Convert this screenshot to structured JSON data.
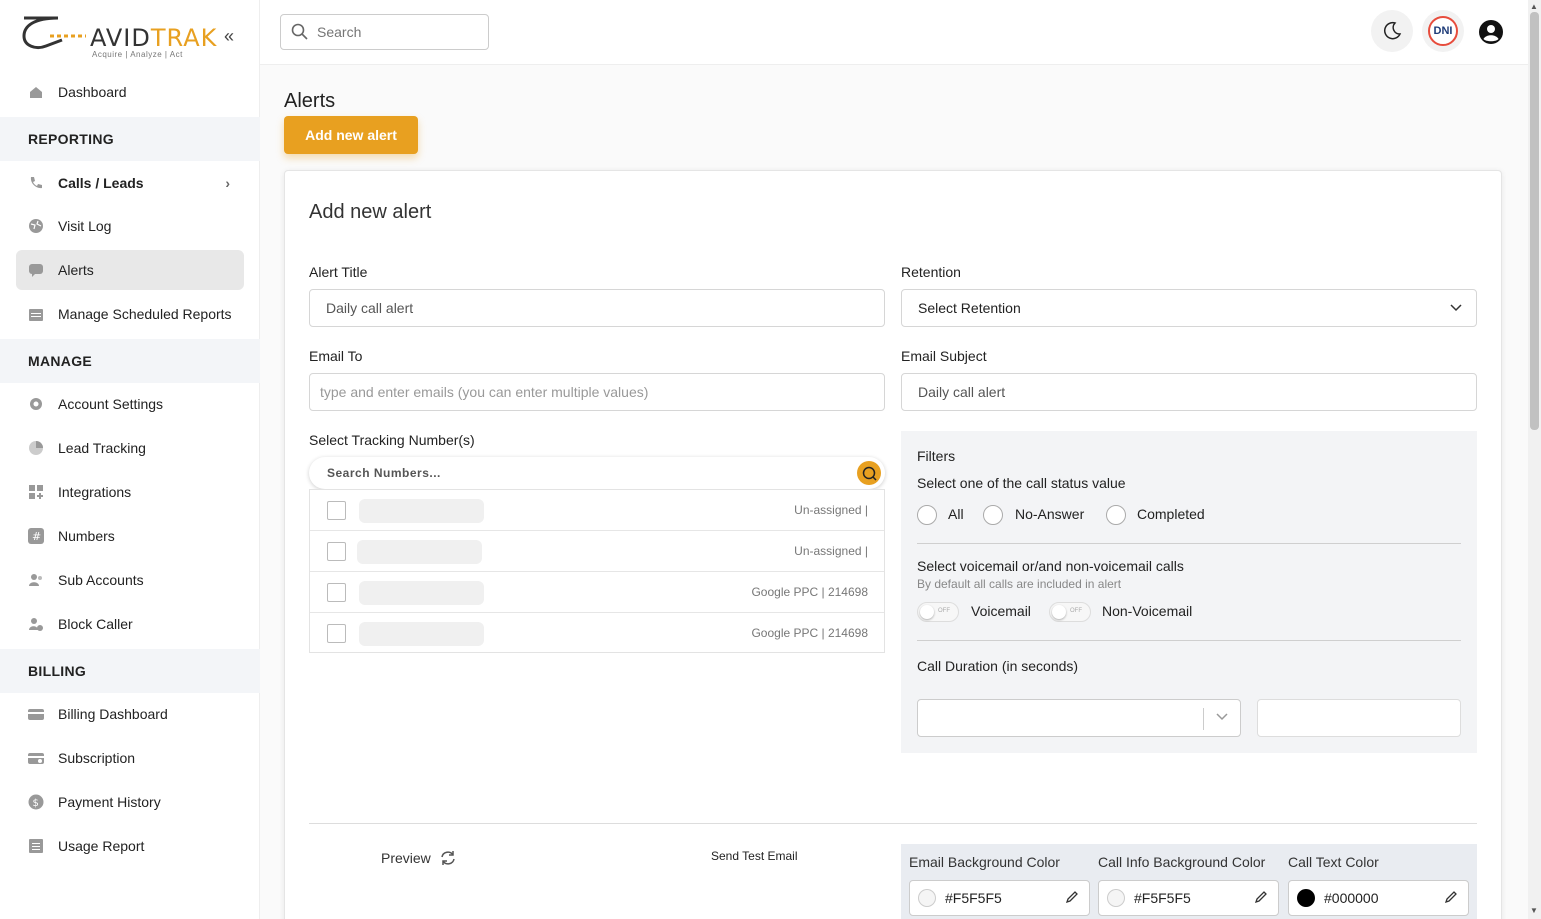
{
  "brand": {
    "name_a": "AVID",
    "name_b": "TRAK",
    "tagline": "Acquire  |  Analyze  |  Act"
  },
  "sidebar": {
    "dashboard": "Dashboard",
    "sections": {
      "reporting": "REPORTING",
      "manage": "MANAGE",
      "billing": "BILLING"
    },
    "reporting_items": [
      "Calls / Leads",
      "Visit Log",
      "Alerts",
      "Manage Scheduled Reports"
    ],
    "manage_items": [
      "Account Settings",
      "Lead Tracking",
      "Integrations",
      "Numbers",
      "Sub Accounts",
      "Block Caller"
    ],
    "billing_items": [
      "Billing Dashboard",
      "Subscription",
      "Payment History",
      "Usage Report"
    ]
  },
  "topbar": {
    "search_placeholder": "Search",
    "dni_label": "DNI"
  },
  "page": {
    "title": "Alerts",
    "add_button": "Add new alert"
  },
  "form": {
    "title": "Add new alert",
    "alert_title_label": "Alert Title",
    "alert_title_value": "Daily call alert",
    "retention_label": "Retention",
    "retention_value": "Select Retention",
    "email_to_label": "Email To",
    "email_to_placeholder": "type and enter emails (you can enter multiple values)",
    "email_subject_label": "Email Subject",
    "email_subject_value": "Daily call alert",
    "tracking_label": "Select Tracking Number(s)",
    "number_search_placeholder": "Search Numbers...",
    "numbers": [
      {
        "source": "Un-assigned |"
      },
      {
        "source": "Un-assigned |"
      },
      {
        "source": "Google PPC | 214698"
      },
      {
        "source": "Google PPC | 214698"
      }
    ]
  },
  "filters": {
    "title": "Filters",
    "status_prompt": "Select one of the call status value",
    "status_options": [
      "All",
      "No-Answer",
      "Completed"
    ],
    "voicemail_prompt": "Select voicemail or/and non-voicemail calls",
    "voicemail_hint": "By default all calls are included in alert",
    "toggle_off": "OFF",
    "voicemail_label": "Voicemail",
    "non_voicemail_label": "Non-Voicemail",
    "duration_label": "Call Duration (in seconds)"
  },
  "footer": {
    "preview_label": "Preview",
    "send_test_label": "Send Test Email",
    "colors": [
      {
        "label": "Email Background Color",
        "value": "#F5F5F5",
        "swatch": "#F5F5F5"
      },
      {
        "label": "Call Info Background Color",
        "value": "#F5F5F5",
        "swatch": "#F5F5F5"
      },
      {
        "label": "Call Text Color",
        "value": "#000000",
        "swatch": "#000000"
      }
    ]
  },
  "colors": {
    "accent": "#E8A020",
    "active_nav": "#E8E8E8",
    "section_bg": "#F3F5F8"
  }
}
